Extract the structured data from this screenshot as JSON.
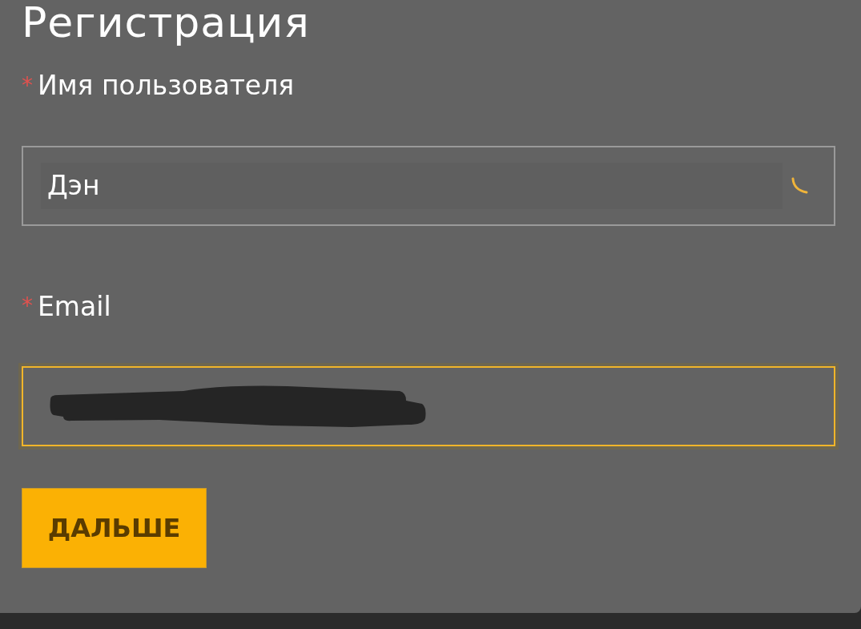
{
  "title": "Регистрация",
  "fields": [
    {
      "required_mark": "*",
      "label": "Имя пользователя",
      "value": "Дэн",
      "focused": false,
      "loading": true
    },
    {
      "required_mark": "*",
      "label": "Email",
      "focused": true,
      "redacted": true
    }
  ],
  "submit_button": "ДАЛЬШЕ"
}
